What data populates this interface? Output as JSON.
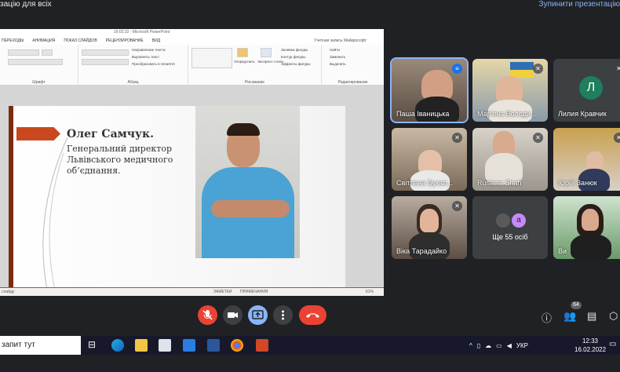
{
  "banner": {
    "left_text": "зацію для всіх",
    "right_link": "Зупинити презентацію"
  },
  "ppt": {
    "window_title": "16:02:22 - Microsoft PowerPoint",
    "tabs": [
      "ПЕРЕХОДЫ",
      "АНИМАЦИЯ",
      "ПОКАЗ СЛАЙДОВ",
      "РЕЦЕНЗИРОВАНИЕ",
      "ВИД"
    ],
    "user": "Учетная запись Майкрософт",
    "ribbon": {
      "group_font": "Шрифт",
      "group_paragraph": "Абзац",
      "group_drawing": "Рисование",
      "group_editing": "Редактирование",
      "text_direction": "Направление текста",
      "align_text": "Выровнять текст",
      "smartart": "Преобразовать в SmartArt",
      "arrange": "Упорядочить",
      "quick_styles": "Экспресс-стили",
      "shape_fill": "Заливка фигуры",
      "shape_outline": "Контур фигуры",
      "shape_effects": "Эффекты фигуры",
      "find": "Найти",
      "replace": "Заменить",
      "select": "Выделить"
    },
    "slide": {
      "name": "Олег Самчук.",
      "role": "Генеральний директор Львівського медичного об’єднання."
    },
    "status": {
      "left": "слайду",
      "notes": "ЗАМЕТКИ",
      "comments": "ПРИМЕЧАНИЯ",
      "zoom": "61%"
    }
  },
  "participants": [
    {
      "name": "Паша Іваницька",
      "speaking": true
    },
    {
      "name": "Мар'яна Володи...",
      "speaking": false
    },
    {
      "name": "Лилия Кравчик",
      "speaking": false,
      "initial": "Л"
    },
    {
      "name": "Світлана Букал...",
      "speaking": false
    },
    {
      "name": "Ruslana Shah",
      "speaking": false
    },
    {
      "name": "Юрій Занюк",
      "speaking": false
    },
    {
      "name": "Віка Тарадайко",
      "speaking": false
    },
    {
      "name": "Ще 55 осіб",
      "speaking": false,
      "initial": "a"
    },
    {
      "name": "Ви",
      "speaking": false
    }
  ],
  "controls": {
    "people_count": "64"
  },
  "taskbar": {
    "search": "запит тут",
    "lang": "УКР",
    "time": "12:33",
    "date": "16.02.2022"
  }
}
